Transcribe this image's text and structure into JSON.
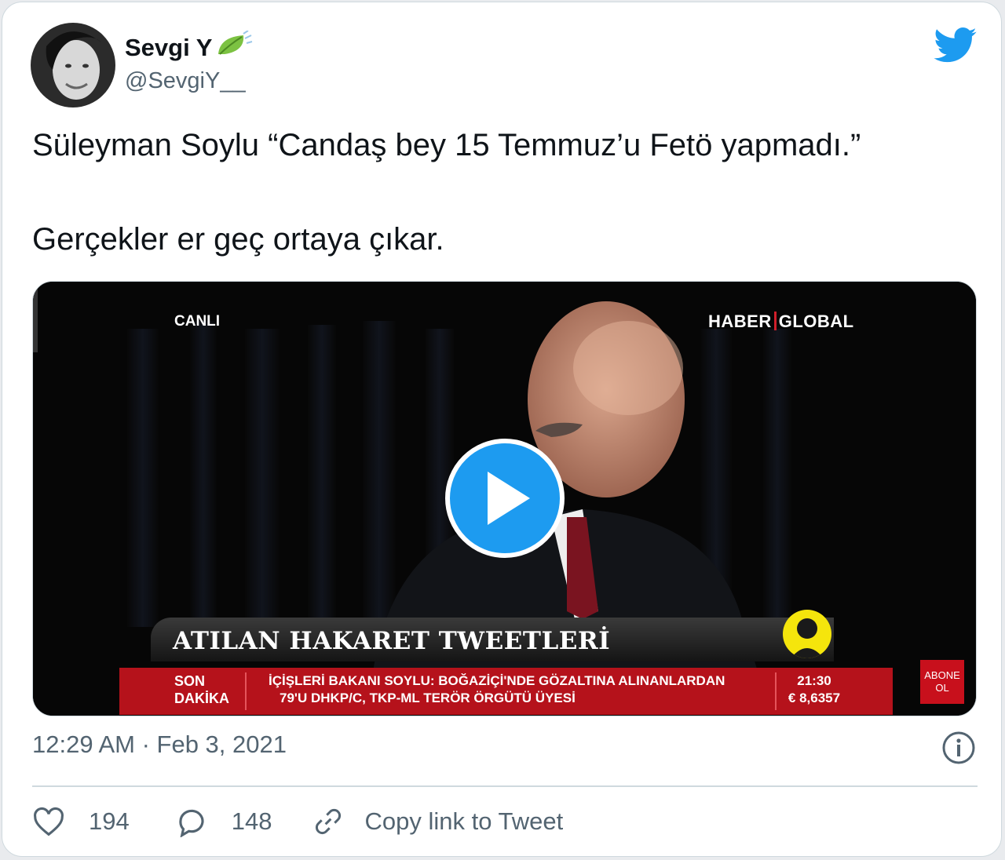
{
  "author": {
    "name": "Sevgi Y",
    "handle": "@SevgiY__"
  },
  "tweet": {
    "text": "Süleyman Soylu “Candaş bey 15 Temmuz’u Fetö yapmadı.”\n\nGerçekler er geç ortaya çıkar."
  },
  "video": {
    "live_label": "CANLI",
    "channel_left": "HABER",
    "channel_right": "GLOBAL",
    "banner": "ATILAN HAKARET TWEETLERİ",
    "ticker_label_1": "SON",
    "ticker_label_2": "DAKİKA",
    "ticker_line_1": "İÇİŞLERİ BAKANI SOYLU: BOĞAZİÇİ'NDE GÖZALTINA ALINANLARDAN",
    "ticker_line_2": "79'U DHKP/C, TKP-ML TERÖR ÖRGÜTÜ ÜYESİ",
    "ticker_time": "21:30",
    "ticker_rate": "€ 8,6357",
    "abone_1": "ABONE",
    "abone_2": "OL"
  },
  "meta": {
    "timestamp": "12:29 AM · Feb 3, 2021"
  },
  "actions": {
    "likes": "194",
    "replies": "148",
    "copy_link": "Copy link to Tweet"
  },
  "colors": {
    "twitter_blue": "#1d9bf0",
    "ticker_red": "#b5121b",
    "text_primary": "#0f1419",
    "text_secondary": "#536471"
  },
  "icons": [
    "twitter-bird-icon",
    "leaf-icon",
    "play-icon",
    "info-icon",
    "heart-icon",
    "reply-icon",
    "link-icon"
  ]
}
